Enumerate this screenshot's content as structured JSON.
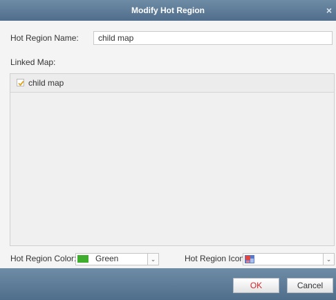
{
  "dialog": {
    "title": "Modify Hot Region",
    "close_glyph": "×"
  },
  "form": {
    "name_label": "Hot Region Name:",
    "name_value": "child map",
    "linked_map_label": "Linked Map:",
    "linked_maps": [
      {
        "label": "child map",
        "checked": true
      }
    ],
    "color_label": "Hot Region Color:",
    "color_value": "Green",
    "color_swatch": "#3fae2e",
    "icon_label": "Hot Region Icon:",
    "icon_name": "hot-region-map-icon",
    "icon_value": ""
  },
  "buttons": {
    "ok_label": "OK",
    "cancel_label": "Cancel"
  },
  "colors": {
    "titlebar": "#5b7a97",
    "footer": "#5b7a97",
    "ok_text": "#d0262a"
  }
}
